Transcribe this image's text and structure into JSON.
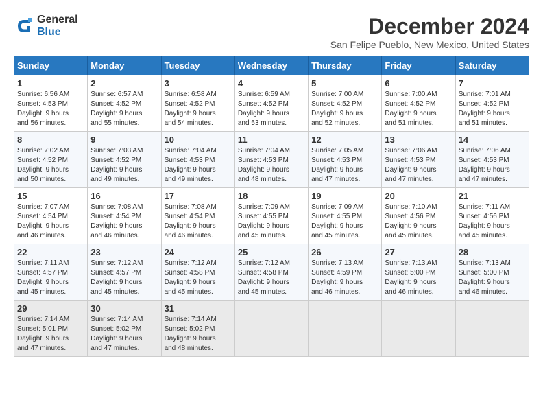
{
  "logo": {
    "general": "General",
    "blue": "Blue"
  },
  "title": "December 2024",
  "subtitle": "San Felipe Pueblo, New Mexico, United States",
  "weekdays": [
    "Sunday",
    "Monday",
    "Tuesday",
    "Wednesday",
    "Thursday",
    "Friday",
    "Saturday"
  ],
  "weeks": [
    [
      {
        "day": "1",
        "sunrise": "6:56 AM",
        "sunset": "4:53 PM",
        "daylight": "9 hours and 56 minutes."
      },
      {
        "day": "2",
        "sunrise": "6:57 AM",
        "sunset": "4:52 PM",
        "daylight": "9 hours and 55 minutes."
      },
      {
        "day": "3",
        "sunrise": "6:58 AM",
        "sunset": "4:52 PM",
        "daylight": "9 hours and 54 minutes."
      },
      {
        "day": "4",
        "sunrise": "6:59 AM",
        "sunset": "4:52 PM",
        "daylight": "9 hours and 53 minutes."
      },
      {
        "day": "5",
        "sunrise": "7:00 AM",
        "sunset": "4:52 PM",
        "daylight": "9 hours and 52 minutes."
      },
      {
        "day": "6",
        "sunrise": "7:00 AM",
        "sunset": "4:52 PM",
        "daylight": "9 hours and 51 minutes."
      },
      {
        "day": "7",
        "sunrise": "7:01 AM",
        "sunset": "4:52 PM",
        "daylight": "9 hours and 51 minutes."
      }
    ],
    [
      {
        "day": "8",
        "sunrise": "7:02 AM",
        "sunset": "4:52 PM",
        "daylight": "9 hours and 50 minutes."
      },
      {
        "day": "9",
        "sunrise": "7:03 AM",
        "sunset": "4:52 PM",
        "daylight": "9 hours and 49 minutes."
      },
      {
        "day": "10",
        "sunrise": "7:04 AM",
        "sunset": "4:53 PM",
        "daylight": "9 hours and 49 minutes."
      },
      {
        "day": "11",
        "sunrise": "7:04 AM",
        "sunset": "4:53 PM",
        "daylight": "9 hours and 48 minutes."
      },
      {
        "day": "12",
        "sunrise": "7:05 AM",
        "sunset": "4:53 PM",
        "daylight": "9 hours and 47 minutes."
      },
      {
        "day": "13",
        "sunrise": "7:06 AM",
        "sunset": "4:53 PM",
        "daylight": "9 hours and 47 minutes."
      },
      {
        "day": "14",
        "sunrise": "7:06 AM",
        "sunset": "4:53 PM",
        "daylight": "9 hours and 47 minutes."
      }
    ],
    [
      {
        "day": "15",
        "sunrise": "7:07 AM",
        "sunset": "4:54 PM",
        "daylight": "9 hours and 46 minutes."
      },
      {
        "day": "16",
        "sunrise": "7:08 AM",
        "sunset": "4:54 PM",
        "daylight": "9 hours and 46 minutes."
      },
      {
        "day": "17",
        "sunrise": "7:08 AM",
        "sunset": "4:54 PM",
        "daylight": "9 hours and 46 minutes."
      },
      {
        "day": "18",
        "sunrise": "7:09 AM",
        "sunset": "4:55 PM",
        "daylight": "9 hours and 45 minutes."
      },
      {
        "day": "19",
        "sunrise": "7:09 AM",
        "sunset": "4:55 PM",
        "daylight": "9 hours and 45 minutes."
      },
      {
        "day": "20",
        "sunrise": "7:10 AM",
        "sunset": "4:56 PM",
        "daylight": "9 hours and 45 minutes."
      },
      {
        "day": "21",
        "sunrise": "7:11 AM",
        "sunset": "4:56 PM",
        "daylight": "9 hours and 45 minutes."
      }
    ],
    [
      {
        "day": "22",
        "sunrise": "7:11 AM",
        "sunset": "4:57 PM",
        "daylight": "9 hours and 45 minutes."
      },
      {
        "day": "23",
        "sunrise": "7:12 AM",
        "sunset": "4:57 PM",
        "daylight": "9 hours and 45 minutes."
      },
      {
        "day": "24",
        "sunrise": "7:12 AM",
        "sunset": "4:58 PM",
        "daylight": "9 hours and 45 minutes."
      },
      {
        "day": "25",
        "sunrise": "7:12 AM",
        "sunset": "4:58 PM",
        "daylight": "9 hours and 45 minutes."
      },
      {
        "day": "26",
        "sunrise": "7:13 AM",
        "sunset": "4:59 PM",
        "daylight": "9 hours and 46 minutes."
      },
      {
        "day": "27",
        "sunrise": "7:13 AM",
        "sunset": "5:00 PM",
        "daylight": "9 hours and 46 minutes."
      },
      {
        "day": "28",
        "sunrise": "7:13 AM",
        "sunset": "5:00 PM",
        "daylight": "9 hours and 46 minutes."
      }
    ],
    [
      {
        "day": "29",
        "sunrise": "7:14 AM",
        "sunset": "5:01 PM",
        "daylight": "9 hours and 47 minutes."
      },
      {
        "day": "30",
        "sunrise": "7:14 AM",
        "sunset": "5:02 PM",
        "daylight": "9 hours and 47 minutes."
      },
      {
        "day": "31",
        "sunrise": "7:14 AM",
        "sunset": "5:02 PM",
        "daylight": "9 hours and 48 minutes."
      },
      null,
      null,
      null,
      null
    ]
  ]
}
